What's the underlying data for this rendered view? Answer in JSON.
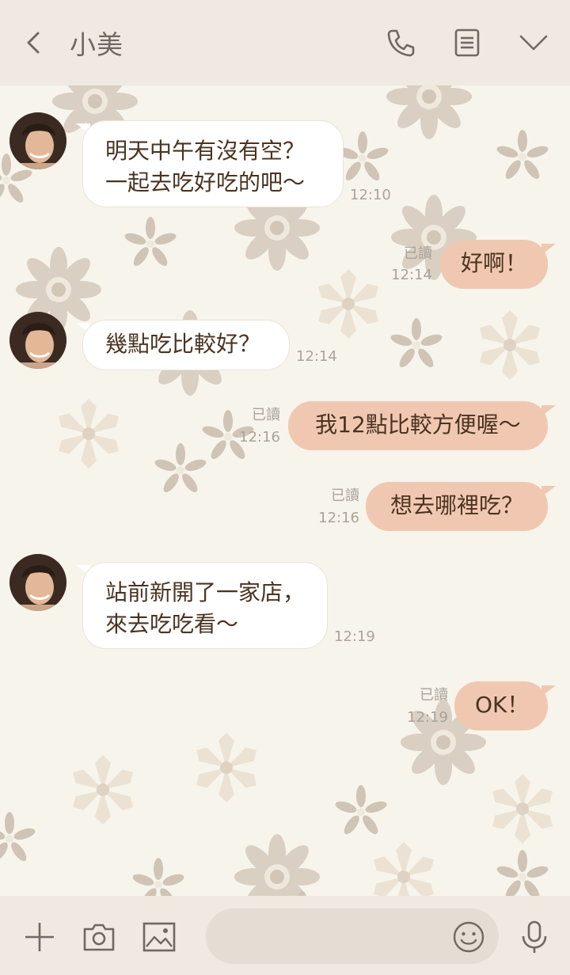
{
  "header": {
    "title": "小美"
  },
  "icons": {
    "back": "chevron-left-icon",
    "call": "phone-icon",
    "notes": "notes-icon",
    "menu": "chevron-down-icon",
    "add": "plus-icon",
    "camera": "camera-icon",
    "gallery": "image-icon",
    "emoji": "emoji-icon",
    "voice": "microphone-icon"
  },
  "messages": [
    {
      "side": "left",
      "lines": [
        "明天中午有沒有空？",
        "一起去吃好吃的吧～"
      ],
      "time": "12:10"
    },
    {
      "side": "right",
      "text": "好啊！",
      "read": "已讀",
      "time": "12:14"
    },
    {
      "side": "left",
      "lines": [
        "幾點吃比較好？"
      ],
      "time": "12:14"
    },
    {
      "side": "right",
      "text": "我12點比較方便喔～",
      "read": "已讀",
      "time": "12:16"
    },
    {
      "side": "right",
      "text": "想去哪裡吃？",
      "read": "已讀",
      "time": "12:16"
    },
    {
      "side": "left",
      "lines": [
        "站前新開了一家店，",
        "來去吃吃看～"
      ],
      "time": "12:19"
    },
    {
      "side": "right",
      "text": "OK！",
      "read": "已讀",
      "time": "12:19"
    }
  ],
  "composer": {
    "value": "",
    "placeholder": ""
  },
  "colors": {
    "header_bg": "#efe9e1",
    "chat_bg": "#f7f4ec",
    "my_bubble": "#f0c8b2",
    "their_bubble": "#ffffff",
    "text": "#4a3320",
    "meta": "#a9a39b"
  }
}
